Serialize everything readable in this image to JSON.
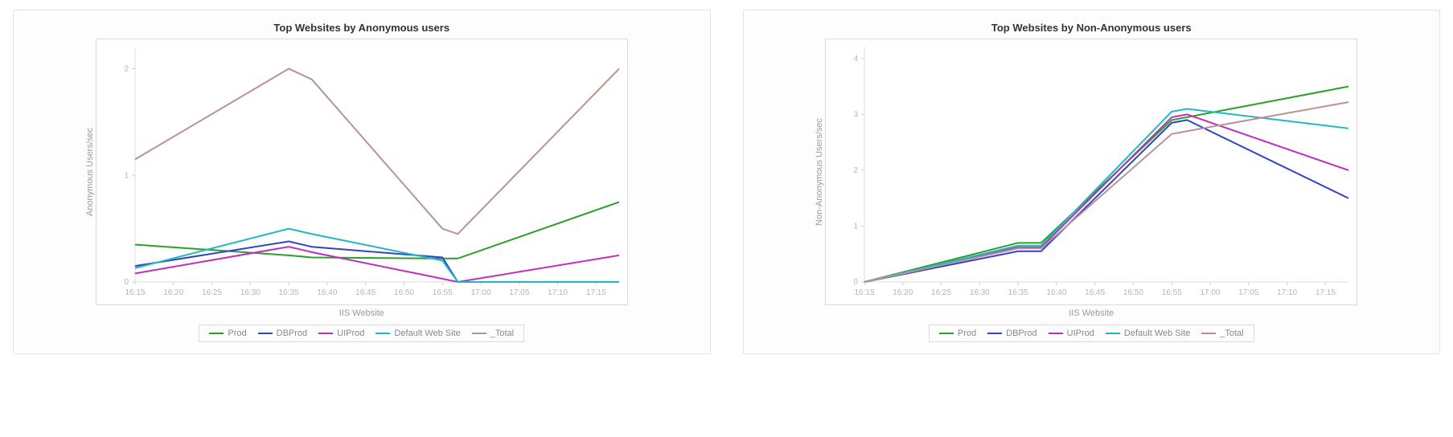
{
  "colors": {
    "Prod": "#2aa02a",
    "DBProd": "#3344c0",
    "UIProd": "#c02dbf",
    "Default": "#1fb8c4",
    "Total": "#b89393"
  },
  "chart_data": [
    {
      "id": "anon",
      "type": "line",
      "title": "Top Websites by Anonymous users",
      "xlabel": "IIS Website",
      "ylabel": "Anonymous Users/sec",
      "categories": [
        "16:15",
        "16:20",
        "16:25",
        "16:30",
        "16:35",
        "16:40",
        "16:45",
        "16:50",
        "16:55",
        "17:00",
        "17:05",
        "17:10",
        "17:15"
      ],
      "x": [
        "16:15",
        "16:35",
        "16:38",
        "16:55",
        "16:57",
        "17:18"
      ],
      "ylim": [
        0,
        2.2
      ],
      "yticks": [
        0,
        1,
        2
      ],
      "series": [
        {
          "name": "Prod",
          "color": "Prod",
          "values": [
            0.35,
            0.25,
            0.23,
            0.22,
            0.22,
            0.75
          ]
        },
        {
          "name": "DBProd",
          "color": "DBProd",
          "values": [
            0.15,
            0.38,
            0.33,
            0.23,
            0.0,
            0.0
          ]
        },
        {
          "name": "UIProd",
          "color": "UIProd",
          "values": [
            0.08,
            0.33,
            0.28,
            0.03,
            0.0,
            0.25
          ]
        },
        {
          "name": "Default Web Site",
          "color": "Default",
          "values": [
            0.13,
            0.5,
            0.45,
            0.2,
            0.0,
            0.0
          ]
        },
        {
          "name": "_Total",
          "color": "Total",
          "values": [
            1.15,
            2.0,
            1.9,
            0.5,
            0.45,
            2.0
          ]
        }
      ]
    },
    {
      "id": "nonanon",
      "type": "line",
      "title": "Top Websites by Non-Anonymous users",
      "xlabel": "IIS Website",
      "ylabel": "Non-Anonymous Users/sec",
      "categories": [
        "16:15",
        "16:20",
        "16:25",
        "16:30",
        "16:35",
        "16:40",
        "16:45",
        "16:50",
        "16:55",
        "17:00",
        "17:05",
        "17:10",
        "17:15"
      ],
      "x": [
        "16:15",
        "16:35",
        "16:38",
        "16:55",
        "16:57",
        "17:18"
      ],
      "ylim": [
        0,
        4.2
      ],
      "yticks": [
        0,
        1,
        2,
        3,
        4
      ],
      "series": [
        {
          "name": "Prod",
          "color": "Prod",
          "values": [
            0.0,
            0.7,
            0.7,
            2.9,
            2.95,
            3.5
          ]
        },
        {
          "name": "DBProd",
          "color": "DBProd",
          "values": [
            0.0,
            0.55,
            0.55,
            2.85,
            2.9,
            1.5
          ]
        },
        {
          "name": "UIProd",
          "color": "UIProd",
          "values": [
            0.0,
            0.62,
            0.62,
            2.95,
            3.0,
            2.0
          ]
        },
        {
          "name": "Default Web Site",
          "color": "Default",
          "values": [
            0.0,
            0.65,
            0.65,
            3.05,
            3.1,
            2.75
          ]
        },
        {
          "name": "_Total",
          "color": "Total",
          "values": [
            0.0,
            0.6,
            0.6,
            2.65,
            2.7,
            3.22
          ]
        }
      ]
    }
  ]
}
